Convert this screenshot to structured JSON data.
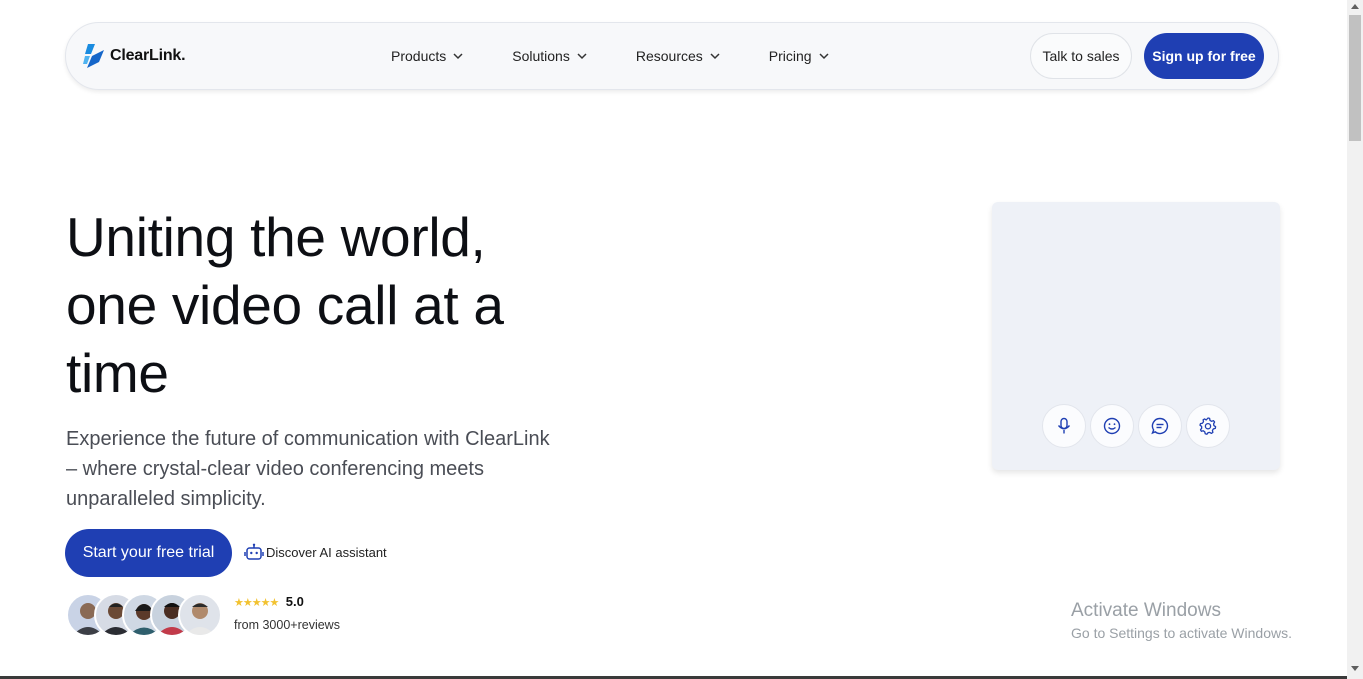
{
  "brand": {
    "name": "ClearLink.",
    "primary_color": "#1f3fb3",
    "logo_color": "#1a8ce0"
  },
  "nav": {
    "items": [
      {
        "label": "Products"
      },
      {
        "label": "Solutions"
      },
      {
        "label": "Resources"
      },
      {
        "label": "Pricing"
      }
    ],
    "talk_label": "Talk to sales",
    "signup_label": "Sign up for free"
  },
  "hero": {
    "title": "Uniting the world, one video call at a time",
    "subtitle": "Experience the future of communication with ClearLink – where crystal-clear video conferencing meets unparalleled simplicity.",
    "cta_label": "Start your free trial",
    "ai_link_label": "Discover AI assistant",
    "ai_icon": "robot-icon"
  },
  "rating": {
    "stars": "★★★★★",
    "score": "5.0",
    "reviews_text": "from 3000+reviews",
    "avatar_count": 5
  },
  "video_controls": [
    {
      "name": "microphone-icon"
    },
    {
      "name": "emoji-icon"
    },
    {
      "name": "chat-icon"
    },
    {
      "name": "settings-icon"
    }
  ],
  "watermark": {
    "title": "Activate Windows",
    "subtitle": "Go to Settings to activate Windows."
  }
}
